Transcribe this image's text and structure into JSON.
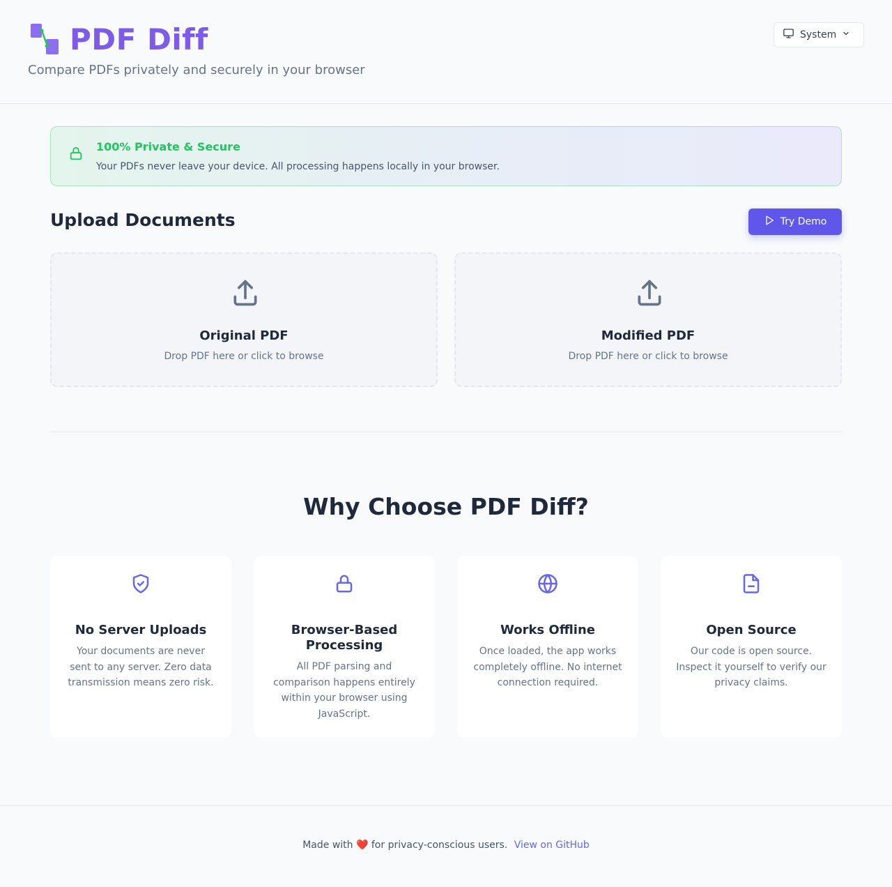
{
  "header": {
    "title": "PDF Diff",
    "tagline": "Compare PDFs privately and securely in your browser",
    "theme_select": {
      "value": "System",
      "icon": "monitor-icon"
    }
  },
  "banner": {
    "title": "100% Private & Secure",
    "text": "Your PDFs never leave your device. All processing happens locally in your browser.",
    "icon": "lock-icon"
  },
  "upload": {
    "title": "Upload Documents",
    "demo_button": "Try Demo",
    "zones": [
      {
        "title": "Original PDF",
        "hint": "Drop PDF here or click to browse",
        "icon": "upload-icon"
      },
      {
        "title": "Modified PDF",
        "hint": "Drop PDF here or click to browse",
        "icon": "upload-icon"
      }
    ]
  },
  "features": {
    "title": "Why Choose PDF Diff?",
    "cards": [
      {
        "title": "No Server Uploads",
        "text": "Your documents are never sent to any server. Zero data transmission means zero risk.",
        "icon": "shield-check-icon"
      },
      {
        "title": "Browser-Based Processing",
        "text": "All PDF parsing and comparison happens entirely within your browser using JavaScript.",
        "icon": "lock-icon"
      },
      {
        "title": "Works Offline",
        "text": "Once loaded, the app works completely offline. No internet connection required.",
        "icon": "globe-icon"
      },
      {
        "title": "Open Source",
        "text": "Our code is open source. Inspect it yourself to verify our privacy claims.",
        "icon": "file-icon"
      }
    ]
  },
  "footer": {
    "text_before": "Made with",
    "heart": "❤️",
    "text_after": "for privacy-conscious users.",
    "link": "View on GitHub"
  },
  "colors": {
    "brand": "#7c5ce8",
    "accent": "#6057ea",
    "success": "#22c55e",
    "link": "#6366f1"
  }
}
